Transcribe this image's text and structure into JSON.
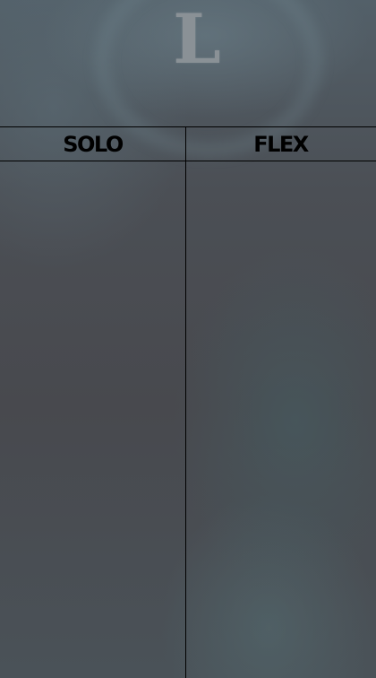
{
  "logo": {
    "letter": "L",
    "icon": "league-logo-icon"
  },
  "table": {
    "columns": [
      {
        "label": "SOLO"
      },
      {
        "label": "FLEX"
      }
    ],
    "rows": []
  },
  "colors": {
    "header_text": "#000000",
    "grid_lines": "#000000",
    "logo": "#8a9196"
  }
}
